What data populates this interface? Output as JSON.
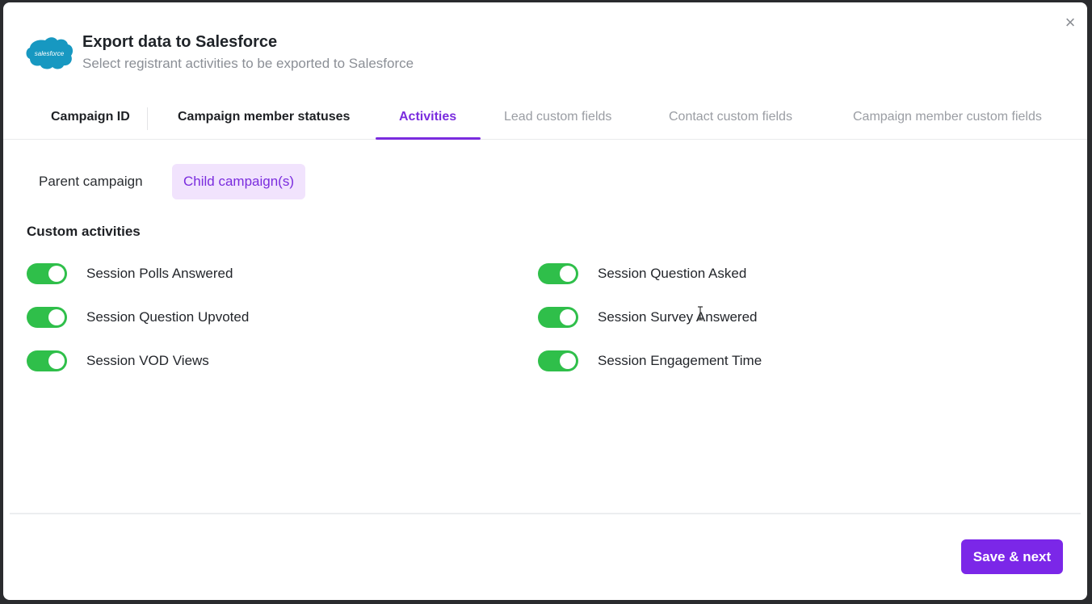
{
  "header": {
    "logo_text": "salesforce",
    "title": "Export data to Salesforce",
    "subtitle": "Select registrant activities to be exported to Salesforce",
    "close_label": "×"
  },
  "tabs": [
    {
      "label": "Campaign ID",
      "state": "completed"
    },
    {
      "label": "Campaign member statuses",
      "state": "completed"
    },
    {
      "label": "Activities",
      "state": "active"
    },
    {
      "label": "Lead custom fields",
      "state": "inactive"
    },
    {
      "label": "Contact custom fields",
      "state": "inactive"
    },
    {
      "label": "Campaign member custom fields",
      "state": "inactive"
    }
  ],
  "subtabs": [
    {
      "label": "Parent campaign",
      "active": false
    },
    {
      "label": "Child campaign(s)",
      "active": true
    }
  ],
  "section": {
    "title": "Custom activities"
  },
  "activities": [
    {
      "label": "Session Polls Answered",
      "enabled": true
    },
    {
      "label": "Session Question Asked",
      "enabled": true
    },
    {
      "label": "Session Question Upvoted",
      "enabled": true
    },
    {
      "label": "Session Survey Answered",
      "enabled": true
    },
    {
      "label": "Session VOD Views",
      "enabled": true
    },
    {
      "label": "Session Engagement Time",
      "enabled": true
    }
  ],
  "footer": {
    "save_label": "Save & next"
  },
  "colors": {
    "accent": "#7a2cde",
    "toggle_on": "#2fbf4a",
    "salesforce_blue": "#1798c1"
  }
}
